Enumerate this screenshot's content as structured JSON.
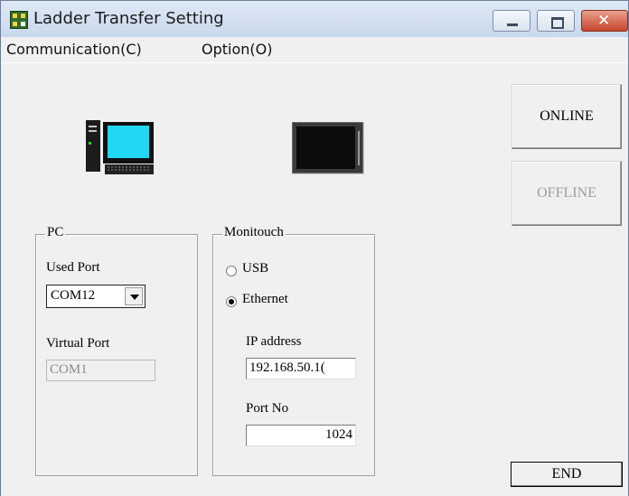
{
  "window": {
    "title": "Ladder Transfer Setting"
  },
  "menu": {
    "communication": "Communication(C)",
    "option": "Option(O)"
  },
  "buttons": {
    "online": "ONLINE",
    "offline": "OFFLINE",
    "end": "END"
  },
  "pc": {
    "group_label": "PC",
    "used_port_label": "Used Port",
    "used_port_value": "COM12",
    "virtual_port_label": "Virtual Port",
    "virtual_port_value": "COM1"
  },
  "monitouch": {
    "group_label": "Monitouch",
    "usb_label": "USB",
    "ethernet_label": "Ethernet",
    "selected": "Ethernet",
    "ip_label": "IP address",
    "ip_value": "192.168.50.1(",
    "port_label": "Port No",
    "port_value": "1024"
  },
  "icons": [
    "app-icon",
    "pc-computer-icon",
    "monitouch-panel-icon",
    "minimize-icon",
    "maximize-icon",
    "close-icon"
  ]
}
